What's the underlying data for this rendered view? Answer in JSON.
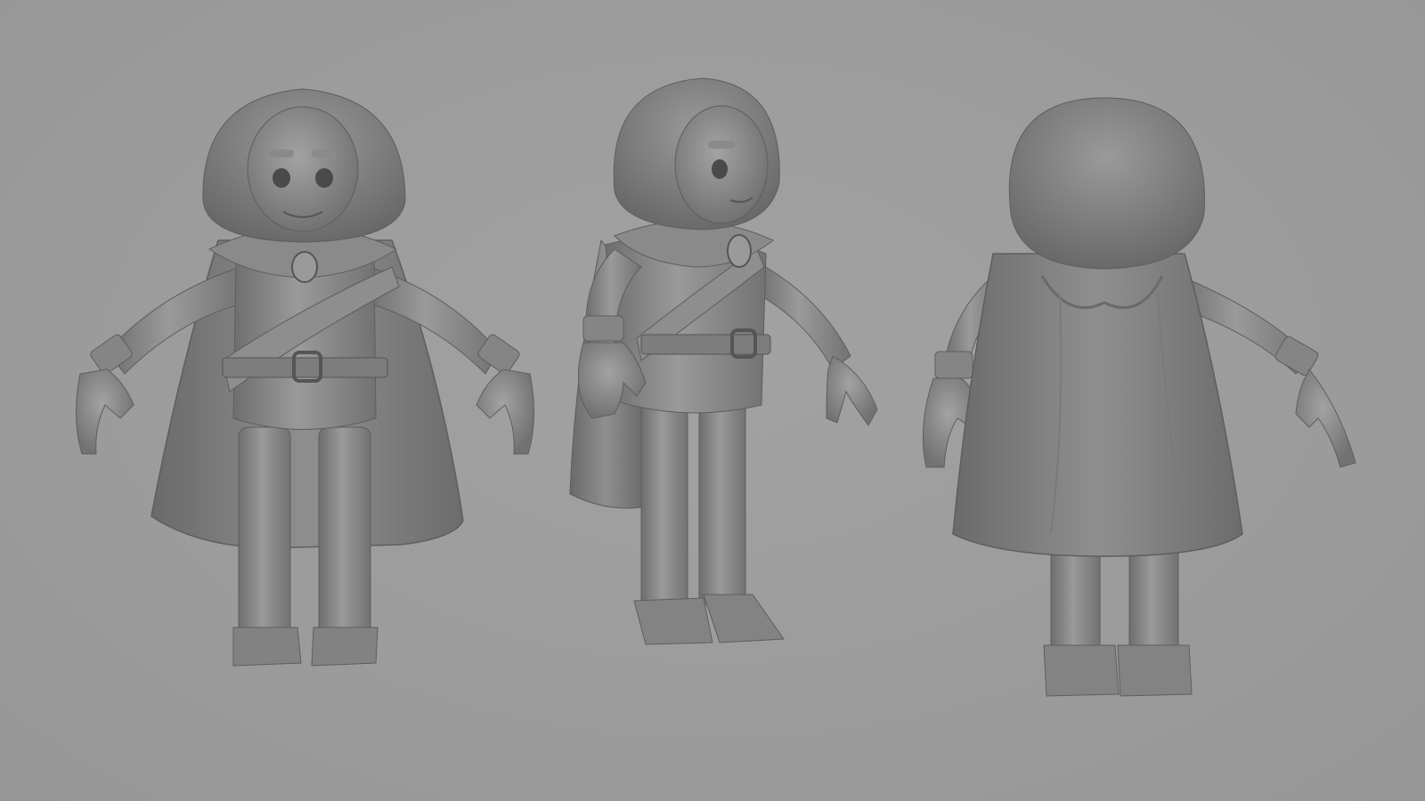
{
  "scene": {
    "background_color": "#9c9c9c",
    "model_color": "#8c8c8c",
    "views": [
      {
        "name": "front-view"
      },
      {
        "name": "three-quarter-view"
      },
      {
        "name": "back-view"
      }
    ]
  }
}
